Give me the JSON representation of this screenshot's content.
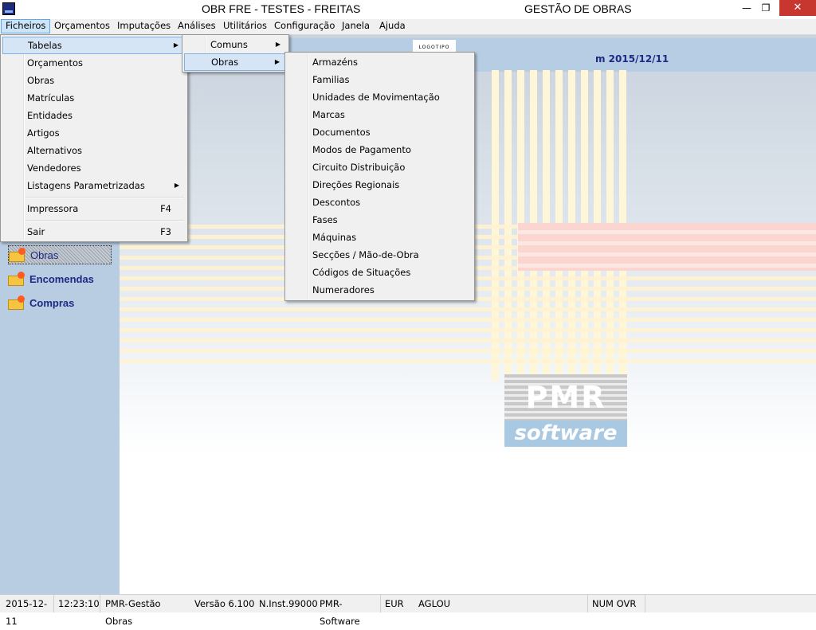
{
  "window": {
    "title_left": "OBR FRE - TESTES - FREITAS",
    "title_right": "GESTÃO DE OBRAS",
    "minimize": "—",
    "maximize": "❐",
    "close": "✕"
  },
  "menubar": [
    {
      "label": "Ficheiros"
    },
    {
      "label": "Orçamentos"
    },
    {
      "label": "Imputações"
    },
    {
      "label": "Análises"
    },
    {
      "label": "Utilitários"
    },
    {
      "label": "Configuração"
    },
    {
      "label": "Janela"
    },
    {
      "label": "Ajuda"
    }
  ],
  "ficheiros_menu": [
    {
      "label": "Tabelas",
      "submenu": true
    },
    {
      "label": "Orçamentos"
    },
    {
      "label": "Obras"
    },
    {
      "label": "Matrículas"
    },
    {
      "label": "Entidades"
    },
    {
      "label": "Artigos"
    },
    {
      "label": "Alternativos"
    },
    {
      "label": "Vendedores"
    },
    {
      "label": "Listagens Parametrizadas",
      "submenu": true
    },
    {
      "label": "Impressora",
      "shortcut": "F4"
    },
    {
      "label": "Sair",
      "shortcut": "F3"
    }
  ],
  "tabelas_menu": [
    {
      "label": "Comuns",
      "submenu": true
    },
    {
      "label": "Obras",
      "submenu": true
    }
  ],
  "obras_menu": [
    {
      "label": "Armazéns"
    },
    {
      "label": "Familias"
    },
    {
      "label": "Unidades de Movimentação"
    },
    {
      "label": "Marcas"
    },
    {
      "label": "Documentos"
    },
    {
      "label": "Modos de Pagamento"
    },
    {
      "label": "Circuito Distribuição"
    },
    {
      "label": "Direções Regionais"
    },
    {
      "label": "Descontos"
    },
    {
      "label": "Fases"
    },
    {
      "label": "Máquinas"
    },
    {
      "label": "Secções / Mão-de-Obra"
    },
    {
      "label": "Códigos de Situações"
    },
    {
      "label": "Numeradores"
    }
  ],
  "header": {
    "logo_tab": "LOGOTIPO",
    "date_label": "m  2015/12/11"
  },
  "sidebar": [
    {
      "label": "Obras",
      "icon": "folder-icon"
    },
    {
      "label": "Encomendas",
      "icon": "folder-icon"
    },
    {
      "label": "Compras",
      "icon": "folder-icon"
    }
  ],
  "brand": {
    "top": "PMR",
    "bottom": "software"
  },
  "statusbar": {
    "date": "2015-12-11",
    "time": "12:23:10",
    "app": "PMR-Gestão Obras",
    "version": "Versão  6.100",
    "inst": "N.Inst.99000",
    "company": "PMR-Software",
    "currency": "EUR",
    "user": "AGLOU",
    "keys": "NUM OVR"
  },
  "colors": {
    "accent": "#1b2a84",
    "sidebar_bg": "#b8cce2",
    "close_btn": "#c7372f",
    "menu_highlight": "#d5e5f6"
  }
}
